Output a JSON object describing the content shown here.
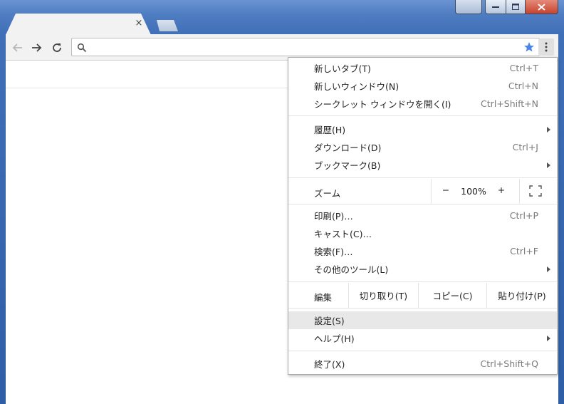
{
  "tab": {
    "close_glyph": "×"
  },
  "omnibox": {
    "value": "",
    "placeholder": ""
  },
  "colors": {
    "accent_star": "#4a86e8",
    "menu_highlight": "#e8e8e8",
    "close_button": "#c7432f"
  },
  "menu": {
    "group1": [
      {
        "label": "新しいタブ(T)",
        "shortcut": "Ctrl+T"
      },
      {
        "label": "新しいウィンドウ(N)",
        "shortcut": "Ctrl+N"
      },
      {
        "label": "シークレット ウィンドウを開く(I)",
        "shortcut": "Ctrl+Shift+N"
      }
    ],
    "group2": [
      {
        "label": "履歴(H)",
        "shortcut": ""
      },
      {
        "label": "ダウンロード(D)",
        "shortcut": "Ctrl+J"
      },
      {
        "label": "ブックマーク(B)",
        "shortcut": ""
      }
    ],
    "zoom": {
      "label": "ズーム",
      "minus": "−",
      "value": "100%",
      "plus": "+"
    },
    "group3": [
      {
        "label": "印刷(P)…",
        "shortcut": "Ctrl+P"
      },
      {
        "label": "キャスト(C)…",
        "shortcut": ""
      },
      {
        "label": "検索(F)…",
        "shortcut": "Ctrl+F"
      },
      {
        "label": "その他のツール(L)",
        "shortcut": ""
      }
    ],
    "edit": {
      "label": "編集",
      "cut": "切り取り(T)",
      "copy": "コピー(C)",
      "paste": "貼り付け(P)"
    },
    "group4": [
      {
        "label": "設定(S)",
        "shortcut": ""
      },
      {
        "label": "ヘルプ(H)",
        "shortcut": ""
      }
    ],
    "exit": {
      "label": "終了(X)",
      "shortcut": "Ctrl+Shift+Q"
    }
  }
}
